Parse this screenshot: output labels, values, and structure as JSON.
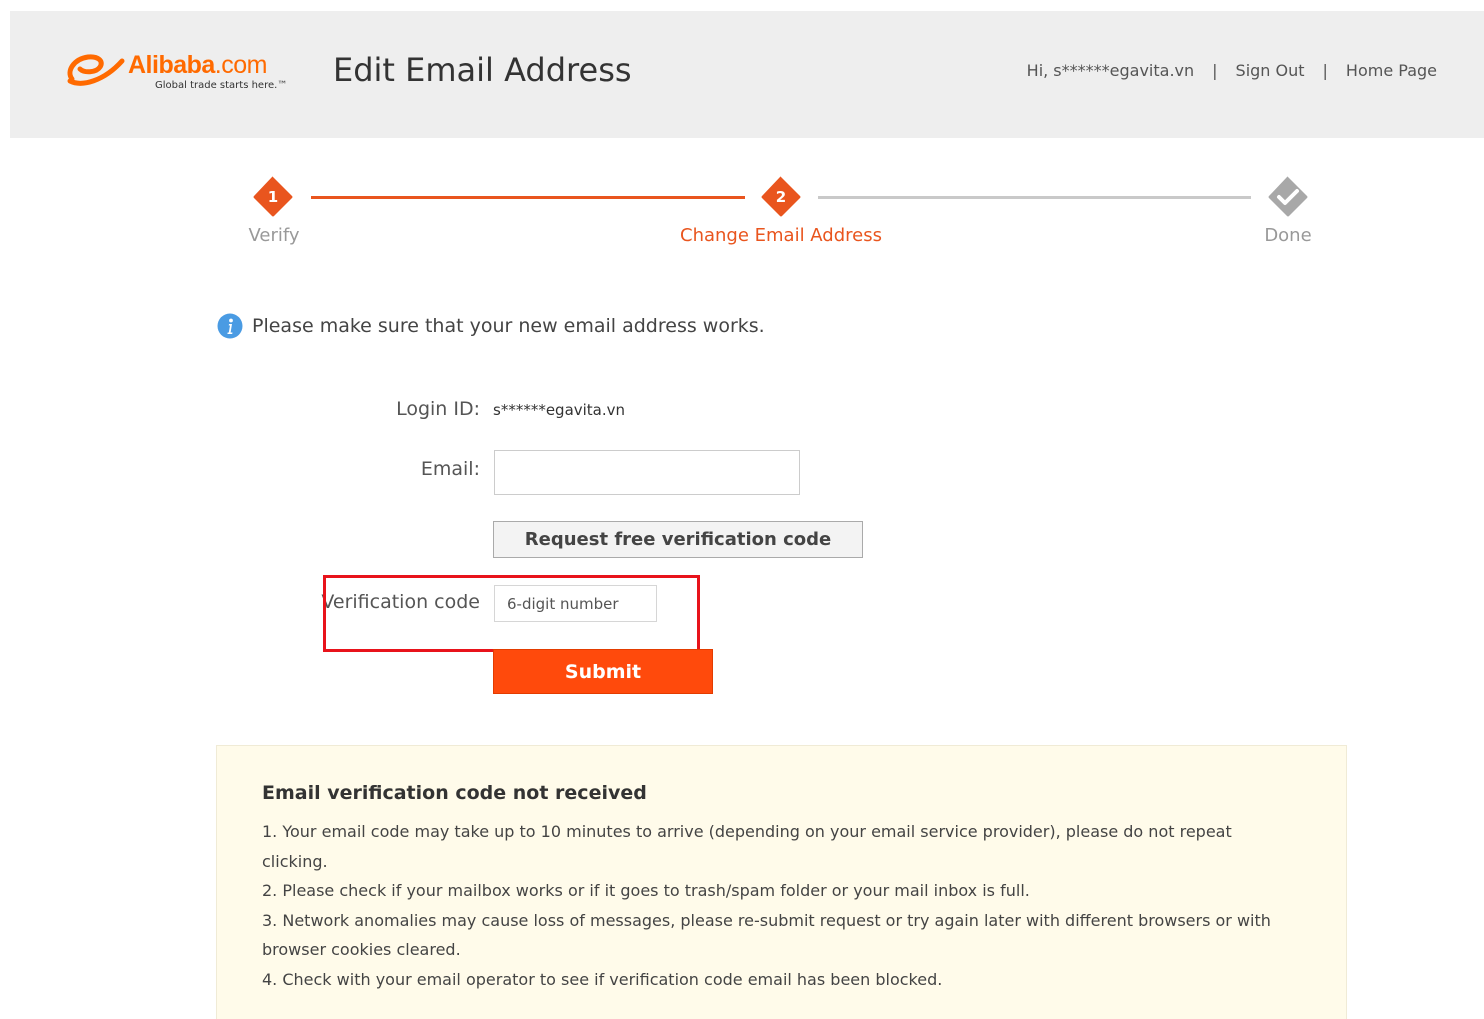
{
  "header": {
    "logo_text": "Alibaba",
    "logo_suffix": ".com",
    "logo_tagline": "Global trade starts here.™",
    "title": "Edit Email Address",
    "greeting": "Hi, s******egavita.vn",
    "sign_out": "Sign Out",
    "home_page": "Home Page",
    "separator": "|"
  },
  "steps": [
    {
      "number": "1",
      "label": "Verify",
      "state": "completed"
    },
    {
      "number": "2",
      "label": "Change Email Address",
      "state": "active"
    },
    {
      "number": "",
      "label": "Done",
      "state": "pending"
    }
  ],
  "notice": {
    "text": "Please make sure that your new email address works."
  },
  "form": {
    "login_label": "Login ID:",
    "login_value": "s******egavita.vn",
    "email_label": "Email:",
    "email_value": "",
    "request_button": "Request free verification code",
    "code_label": "Verification code",
    "code_placeholder": "6-digit number",
    "submit_button": "Submit"
  },
  "help": {
    "title": "Email verification code not received",
    "items": [
      "1. Your email code may take up to 10 minutes to arrive (depending on your email service provider), please do not repeat clicking.",
      "2. Please check if your mailbox works or if it goes to trash/spam folder or your mail inbox is full.",
      "3. Network anomalies may cause loss of messages, please re-submit request or try again later with different browsers or with browser cookies cleared.",
      "4. Check with your email operator to see if verification code email has been blocked."
    ]
  },
  "colors": {
    "accent": "#ff6a00",
    "step_active": "#e9551e",
    "submit": "#ff4a0c",
    "highlight": "#e8131b",
    "help_bg": "#fffbea"
  }
}
